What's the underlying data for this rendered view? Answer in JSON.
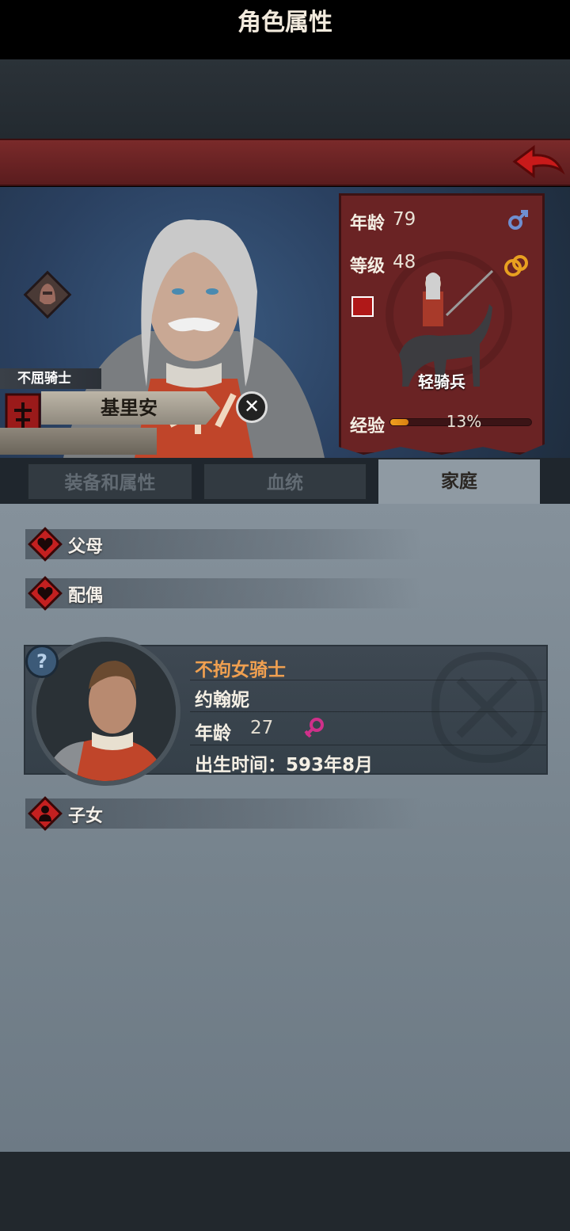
{
  "header": {
    "title": "角色属性"
  },
  "character": {
    "class": "不屈骑士",
    "name": "基里安",
    "age_label": "年龄",
    "age": "79",
    "level_label": "等级",
    "level": "48",
    "unit_type": "轻骑兵",
    "xp_label": "经验",
    "xp_percent": "13%",
    "xp_fraction": 0.13
  },
  "tabs": [
    {
      "label": "装备和属性",
      "active": false
    },
    {
      "label": "血统",
      "active": false
    },
    {
      "label": "家庭",
      "active": true
    }
  ],
  "family": {
    "parents_label": "父母",
    "spouse_label": "配偶",
    "children_label": "子女",
    "spouse": {
      "class": "不拘女骑士",
      "name": "约翰妮",
      "age_label": "年龄",
      "age": "27",
      "birth_text": "出生时间：593年8月"
    }
  },
  "colors": {
    "title_bar": "#6a2224",
    "stats_panel": "#6a2324",
    "accent_orange": "#f0a050",
    "xp_fill": "#f0a020",
    "content_bg": "#7d8a94"
  },
  "icons": {
    "back": "back-arrow-icon",
    "helmet": "helmet-icon",
    "male": "male-icon",
    "female": "female-icon",
    "ring": "ring-icon",
    "heart": "heart-icon",
    "child": "child-icon",
    "help": "question-icon"
  }
}
